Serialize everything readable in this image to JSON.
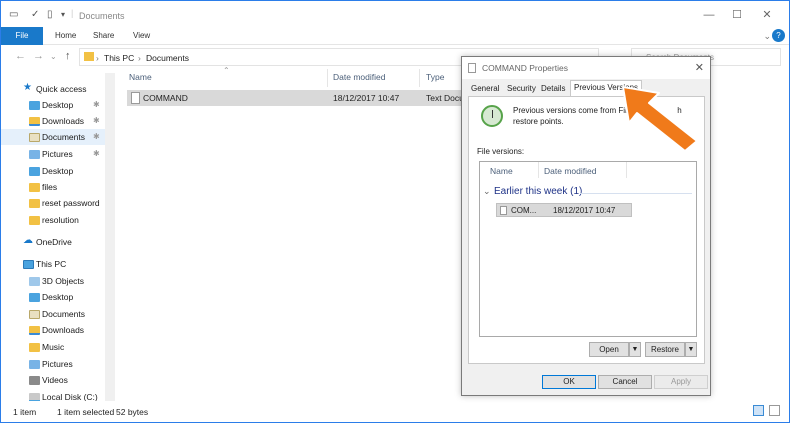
{
  "window": {
    "title": "Documents",
    "controls": {
      "minimize": "—",
      "maximize": "☐",
      "close": "✕"
    }
  },
  "ribbon": {
    "tabs": [
      "File",
      "Home",
      "Share",
      "View"
    ],
    "help": "?"
  },
  "address": {
    "segments": [
      "This PC",
      "Documents"
    ],
    "search_placeholder": "Search Documents"
  },
  "sidebar": {
    "quick_access": "Quick access",
    "items": [
      {
        "label": "Desktop",
        "icon": "desktop-folder-icon",
        "pinned": true
      },
      {
        "label": "Downloads",
        "icon": "downloads-folder-icon",
        "pinned": true
      },
      {
        "label": "Documents",
        "icon": "documents-folder-icon",
        "pinned": true,
        "selected": true
      },
      {
        "label": "Pictures",
        "icon": "pictures-folder-icon",
        "pinned": true
      },
      {
        "label": "Desktop",
        "icon": "desktop-folder-icon"
      },
      {
        "label": "files",
        "icon": "folder-icon"
      },
      {
        "label": "reset password",
        "icon": "folder-icon"
      },
      {
        "label": "resolution",
        "icon": "folder-icon"
      }
    ],
    "onedrive": "OneDrive",
    "this_pc": "This PC",
    "pc_items": [
      {
        "label": "3D Objects",
        "icon": "3d-objects-folder-icon"
      },
      {
        "label": "Desktop",
        "icon": "desktop-folder-icon"
      },
      {
        "label": "Documents",
        "icon": "documents-folder-icon"
      },
      {
        "label": "Downloads",
        "icon": "downloads-folder-icon"
      },
      {
        "label": "Music",
        "icon": "music-folder-icon"
      },
      {
        "label": "Pictures",
        "icon": "pictures-folder-icon"
      },
      {
        "label": "Videos",
        "icon": "videos-folder-icon"
      },
      {
        "label": "Local Disk (C:)",
        "icon": "drive-icon"
      }
    ]
  },
  "filelist": {
    "columns": [
      "Name",
      "Date modified",
      "Type"
    ],
    "rows": [
      {
        "name": "COMMAND",
        "date": "18/12/2017 10:47",
        "type": "Text Docu"
      }
    ]
  },
  "status": {
    "count": "1 item",
    "selected": "1 item selected",
    "size": "52 bytes"
  },
  "dialog": {
    "title": "COMMAND Properties",
    "close": "✕",
    "tabs": [
      "General",
      "Security",
      "Details",
      "Previous Versions"
    ],
    "active_tab": "Previous Versions",
    "description_line1": "Previous versions come from File H",
    "description_line1_end": "h",
    "description_line2": "restore points.",
    "file_versions_label": "File versions:",
    "columns": [
      "Name",
      "Date modified"
    ],
    "group": "Earlier this week (1)",
    "version_row": {
      "name": "COM...",
      "date": "18/12/2017 10:47"
    },
    "open_button": "Open",
    "restore_button": "Restore",
    "ok": "OK",
    "cancel": "Cancel",
    "apply": "Apply"
  },
  "colors": {
    "accent": "#1979ca",
    "arrow": "#f07a1a"
  }
}
